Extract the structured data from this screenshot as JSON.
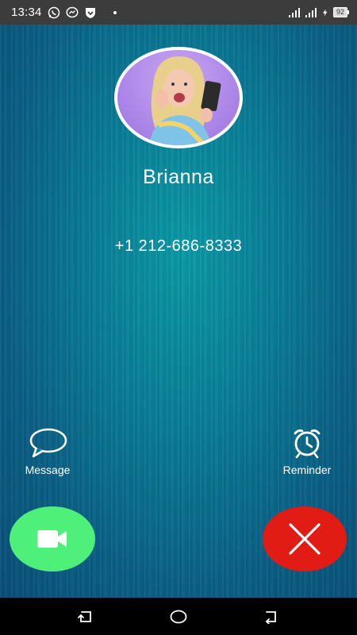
{
  "status_bar": {
    "time": "13:34",
    "battery": "92",
    "icons": [
      "whatsapp-icon",
      "messenger-icon",
      "shield-icon",
      "signal-icon",
      "signal-icon",
      "charging-icon"
    ]
  },
  "caller": {
    "name": "Brianna",
    "number": "+1 212-686-8333"
  },
  "actions": {
    "message_label": "Message",
    "reminder_label": "Reminder"
  },
  "buttons": {
    "accept_icon": "video-camera-icon",
    "decline_icon": "close-icon"
  },
  "colors": {
    "accept": "#4ef07a",
    "decline": "#e01c14",
    "background": "#0a7e97"
  },
  "nav": [
    "recent-apps-icon",
    "home-icon",
    "back-icon"
  ]
}
